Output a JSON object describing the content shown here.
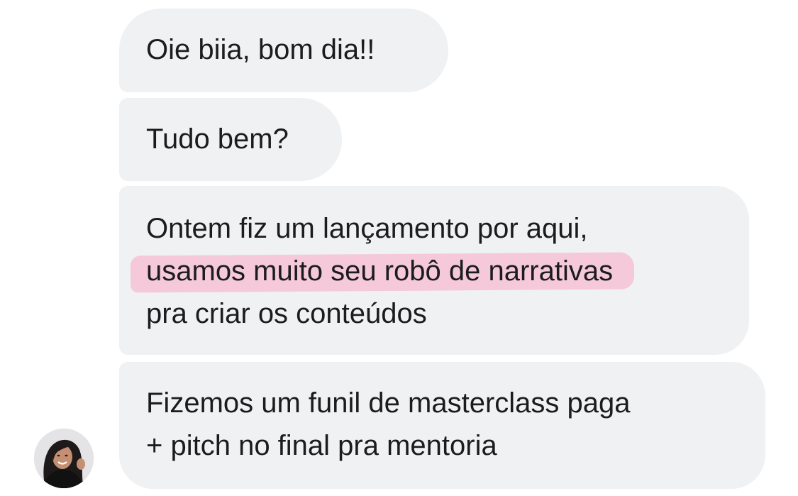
{
  "conversation": {
    "messages": [
      {
        "lines": [
          "Oie biia, bom dia!!"
        ]
      },
      {
        "lines": [
          "Tudo bem?"
        ]
      },
      {
        "lines": [
          "Ontem fiz um lançamento por aqui,",
          "usamos muito seu robô de narrativas",
          "pra criar os conteúdos"
        ],
        "highlighted_line": "usamos muito seu robô de narrativas",
        "highlight_color": "#f4c6d7"
      },
      {
        "lines": [
          "Fizemos um funil de masterclass paga",
          "+ pitch no final pra mentoria"
        ]
      }
    ],
    "bubble_color": "#eff1f3",
    "text_color": "#1c1c1e"
  },
  "sender": {
    "avatar_icon": "profile-photo-avatar"
  }
}
